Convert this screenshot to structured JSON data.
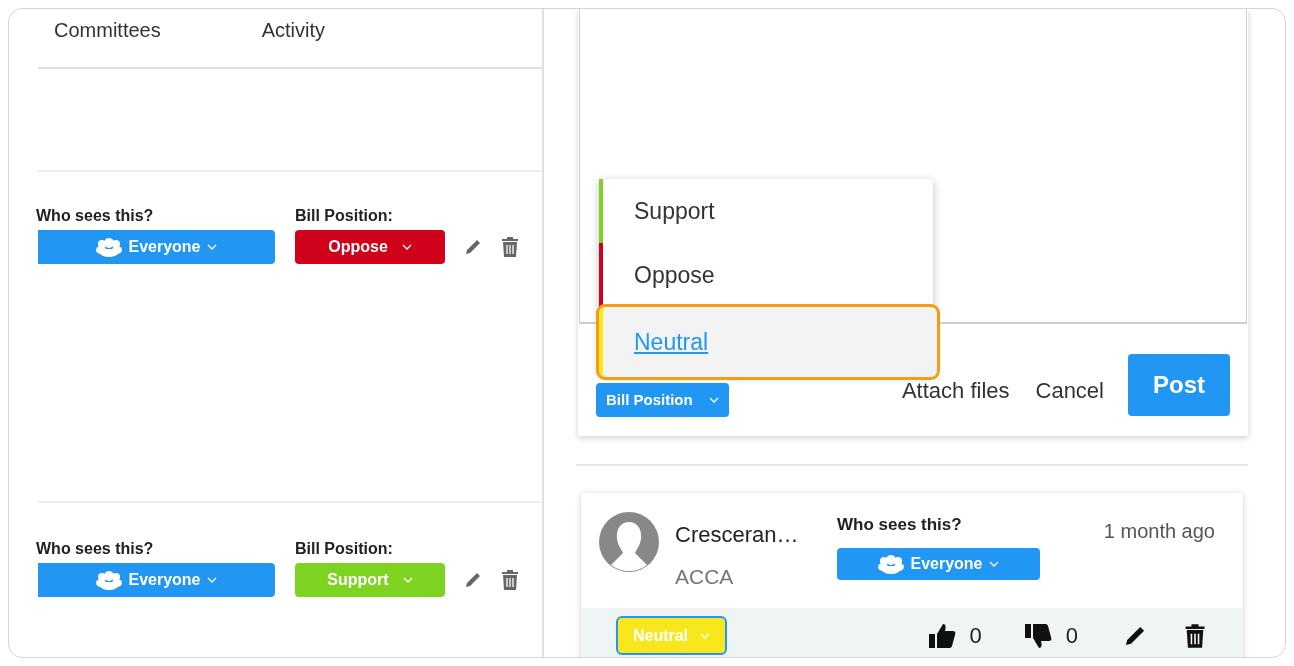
{
  "tabs": [
    {
      "label": "Committees"
    },
    {
      "label": "Activity"
    }
  ],
  "notes": [
    {
      "visibility_label": "Who sees this?",
      "visibility": "Everyone",
      "position_label": "Bill Position:",
      "position": "Oppose",
      "color": "#d0021b"
    },
    {
      "visibility_label": "Who sees this?",
      "visibility": "Everyone",
      "position_label": "Bill Position:",
      "position": "Support",
      "color": "#7ed321"
    }
  ],
  "composer": {
    "position_button": "Bill Position",
    "attach": "Attach files",
    "cancel": "Cancel",
    "post": "Post"
  },
  "position_menu": [
    {
      "label": "Support",
      "color": "#7ed321",
      "selected": false
    },
    {
      "label": "Oppose",
      "color": "#d0021b",
      "selected": false
    },
    {
      "label": "Neutral",
      "color": "#f8e71c",
      "selected": true
    }
  ],
  "comment": {
    "author": "Cresceran…",
    "organization": "ACCA",
    "visibility_label": "Who sees this?",
    "visibility": "Everyone",
    "time": "1 month ago",
    "position": "Neutral",
    "color": "#f8e71c",
    "likes": "0",
    "dislikes": "0"
  }
}
